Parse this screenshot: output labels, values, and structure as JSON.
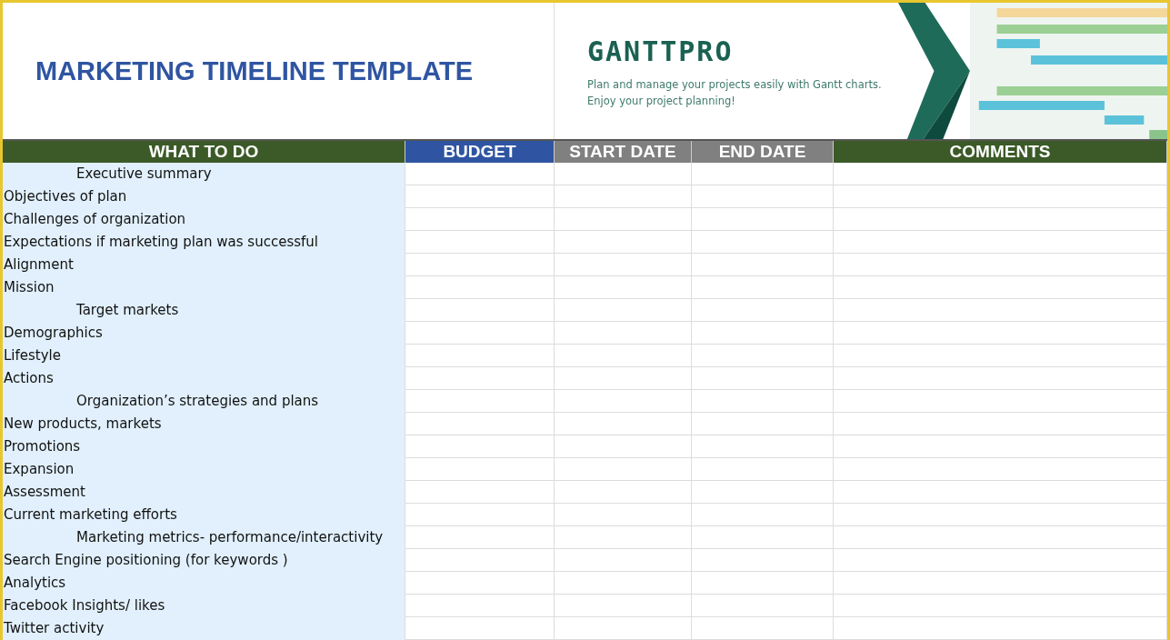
{
  "title": "MARKETING TIMELINE TEMPLATE",
  "banner": {
    "logo": "GANTTPRO",
    "tagline": [
      "Plan and manage your projects easily with Gantt charts.",
      "Enjoy your project planning!"
    ]
  },
  "columns": [
    {
      "label": "WHAT TO DO",
      "color": "#3b5a27"
    },
    {
      "label": "BUDGET",
      "color": "#2f55a2"
    },
    {
      "label": "START DATE",
      "color": "#808080"
    },
    {
      "label": "END DATE",
      "color": "#808080"
    },
    {
      "label": "COMMENTS",
      "color": "#3b5a27"
    }
  ],
  "rows": [
    {
      "kind": "heading",
      "text": "Executive summary"
    },
    {
      "kind": "item",
      "text": "Objectives of plan"
    },
    {
      "kind": "item",
      "text": "Challenges of organization"
    },
    {
      "kind": "item",
      "text": "Expectations if marketing plan was successful"
    },
    {
      "kind": "item",
      "text": "Alignment"
    },
    {
      "kind": "item",
      "text": "Mission"
    },
    {
      "kind": "heading",
      "text": "Target markets"
    },
    {
      "kind": "item",
      "text": "Demographics"
    },
    {
      "kind": "item",
      "text": "Lifestyle"
    },
    {
      "kind": "item",
      "text": "Actions"
    },
    {
      "kind": "heading",
      "text": "Organization’s strategies and plans"
    },
    {
      "kind": "item",
      "text": "New products, markets"
    },
    {
      "kind": "item",
      "text": "Promotions"
    },
    {
      "kind": "item",
      "text": "Expansion"
    },
    {
      "kind": "item",
      "text": "Assessment"
    },
    {
      "kind": "item",
      "text": "Current marketing efforts"
    },
    {
      "kind": "heading",
      "text": "Marketing metrics- performance/interactivity"
    },
    {
      "kind": "item",
      "text": "Search Engine positioning (for keywords )"
    },
    {
      "kind": "item",
      "text": "Analytics"
    },
    {
      "kind": "item",
      "text": "Facebook Insights/ likes"
    },
    {
      "kind": "item",
      "text": "Twitter activity"
    }
  ]
}
